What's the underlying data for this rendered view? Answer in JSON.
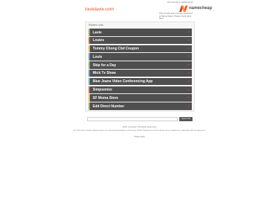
{
  "header": {
    "domain": "louielavie.com",
    "parked_note": "This domain is registered at",
    "logo_text": "namecheap",
    "sale_note": "This domain was recently registered at Namecheap. Please check back later!"
  },
  "related": {
    "title": "Related Links",
    "links": [
      {
        "label": "Lavie"
      },
      {
        "label": "Louies"
      },
      {
        "label": "Tommy Chong Cbd Coupon"
      },
      {
        "label": "Louis"
      },
      {
        "label": "Skip for a Day"
      },
      {
        "label": "Mick Tv Show"
      },
      {
        "label": "Blue Jeans Video Conferencing App"
      },
      {
        "label": "Simpsonize"
      },
      {
        "label": "SF Moma Store"
      },
      {
        "label": "Edd Direct Number"
      }
    ]
  },
  "search": {
    "placeholder": "",
    "button_label": "Search Ads"
  },
  "footer": {
    "copyright": "2022 Copyright. All Rights Reserved.",
    "disclaimer": "The Sponsored Listings displayed above are served automatically by a third party. Neither Parkingcrew nor the domain owner maintain any relationship with the advertisers.",
    "privacy": "Privacy Policy"
  },
  "colors": {
    "accent": "#e8501a",
    "row_bg": "#4f4f4f"
  }
}
